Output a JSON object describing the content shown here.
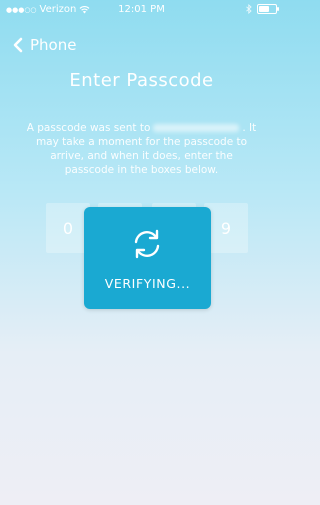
{
  "status_bar": {
    "signal_dots": "●●●○○",
    "carrier": "Verizon",
    "time": "12:01 PM",
    "battery_level": 0.6
  },
  "nav": {
    "back_label": "Phone"
  },
  "header": {
    "title": "Enter Passcode"
  },
  "instructions": {
    "text_before": "A passcode was sent to",
    "text_after": ". It may take a moment for the passcode to arrive, and when it does, enter the passcode in the boxes below."
  },
  "passcode": {
    "digits": [
      "0",
      "",
      "",
      "9"
    ]
  },
  "overlay": {
    "label": "VERIFYING..."
  },
  "colors": {
    "accent": "#1aa9d2",
    "background_top": "#8fdcf0",
    "background_bottom": "#eeeef5"
  },
  "icons": [
    "wifi-icon",
    "bluetooth-icon",
    "battery-icon",
    "chevron-left-icon",
    "sync-icon"
  ]
}
